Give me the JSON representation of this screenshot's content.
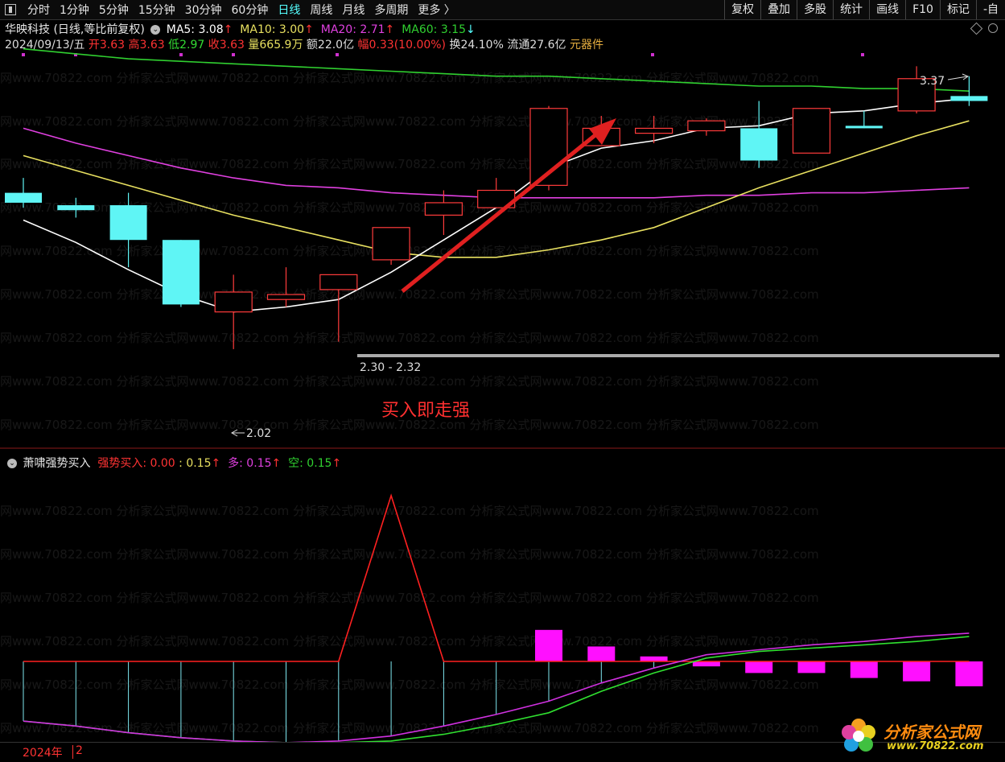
{
  "toolbar": {
    "periods": [
      "分时",
      "1分钟",
      "5分钟",
      "15分钟",
      "30分钟",
      "60分钟",
      "日线",
      "周线",
      "月线",
      "多周期",
      "更多 〉"
    ],
    "active_index": 6,
    "right_buttons": [
      "复权",
      "叠加",
      "多股",
      "统计",
      "画线",
      "F10",
      "标记",
      "-自"
    ]
  },
  "header": {
    "stock_name": "华映科技",
    "chart_mode": "(日线,等比前复权)",
    "ma5": "MA5: 3.08",
    "ma10": "MA10: 3.00",
    "ma20": "MA20: 2.71",
    "ma60": "MA60: 3.15",
    "arrow_up": "↑",
    "arrow_down": "↓",
    "date": "2024/09/13/五",
    "open": "开3.63",
    "high": "高3.63",
    "low": "低2.97",
    "close": "收3.63",
    "volume": "量665.9万",
    "amount": "额22.0亿",
    "change": "幅0.33(10.00%)",
    "turnover": "换24.10%",
    "float": "流通27.6亿",
    "sector": "元器件"
  },
  "annotations": {
    "high_label": "3.37",
    "low_label": "2.02",
    "range_label": "2.30 - 2.32",
    "buy_text": "买入即走强"
  },
  "indicator": {
    "name": "萧啸强势买入",
    "buy_label": "强势买入: 0.00",
    "v1": ": 0.15",
    "duo": "多: 0.15",
    "kong": "空: 0.15"
  },
  "watermark": "网www.70822.com 分析家公式网www.70822.com 分析家公式网www.70822.com 分析家公式网www.70822.com 分析家公式网www.70822.com",
  "bottom": {
    "year": "2024年",
    "page": "2"
  },
  "logo": {
    "name": "分析家公式网",
    "url": "www.70822.com"
  },
  "colors": {
    "up": "#ff3b3b",
    "down": "#5ff5f5",
    "ma5": "#ffffff",
    "ma10": "#e8e060",
    "ma20": "#e040e0",
    "ma60": "#30d030"
  },
  "chart_data": {
    "type": "candlestick",
    "ylim": [
      1.9,
      3.45
    ],
    "candles": [
      {
        "o": 2.9,
        "c": 2.86,
        "h": 2.96,
        "l": 2.84
      },
      {
        "o": 2.85,
        "c": 2.83,
        "h": 2.88,
        "l": 2.8
      },
      {
        "o": 2.85,
        "c": 2.71,
        "h": 2.9,
        "l": 2.6
      },
      {
        "o": 2.71,
        "c": 2.45,
        "h": 2.71,
        "l": 2.44
      },
      {
        "o": 2.42,
        "c": 2.5,
        "h": 2.57,
        "l": 2.27
      },
      {
        "o": 2.47,
        "c": 2.49,
        "h": 2.6,
        "l": 2.44
      },
      {
        "o": 2.51,
        "c": 2.57,
        "h": 2.57,
        "l": 2.3
      },
      {
        "o": 2.63,
        "c": 2.76,
        "h": 2.76,
        "l": 2.61
      },
      {
        "o": 2.81,
        "c": 2.86,
        "h": 2.91,
        "l": 2.73
      },
      {
        "o": 2.84,
        "c": 2.91,
        "h": 2.96,
        "l": 2.84
      },
      {
        "o": 2.93,
        "c": 3.24,
        "h": 3.25,
        "l": 2.91
      },
      {
        "o": 3.09,
        "c": 3.16,
        "h": 3.21,
        "l": 3.09
      },
      {
        "o": 3.14,
        "c": 3.16,
        "h": 3.21,
        "l": 3.1
      },
      {
        "o": 3.15,
        "c": 3.19,
        "h": 3.2,
        "l": 3.13
      },
      {
        "o": 3.16,
        "c": 3.03,
        "h": 3.27,
        "l": 3.0
      },
      {
        "o": 3.06,
        "c": 3.24,
        "h": 3.24,
        "l": 3.06
      },
      {
        "o": 3.17,
        "c": 3.16,
        "h": 3.23,
        "l": 3.16
      },
      {
        "o": 3.23,
        "c": 3.36,
        "h": 3.41,
        "l": 3.22
      },
      {
        "o": 3.29,
        "c": 3.27,
        "h": 3.37,
        "l": 3.25
      }
    ],
    "ma5": [
      2.79,
      2.7,
      2.59,
      2.49,
      2.42,
      2.44,
      2.47,
      2.58,
      2.71,
      2.84,
      3.0,
      3.08,
      3.11,
      3.16,
      3.17,
      3.22,
      3.23,
      3.26,
      3.28
    ],
    "ma10": [
      3.05,
      2.99,
      2.93,
      2.87,
      2.81,
      2.76,
      2.71,
      2.66,
      2.64,
      2.64,
      2.67,
      2.71,
      2.76,
      2.84,
      2.92,
      2.99,
      3.06,
      3.13,
      3.19
    ],
    "ma20": [
      3.16,
      3.1,
      3.05,
      3.0,
      2.96,
      2.93,
      2.92,
      2.9,
      2.89,
      2.88,
      2.88,
      2.88,
      2.88,
      2.89,
      2.89,
      2.9,
      2.9,
      2.91,
      2.92
    ],
    "ma60": [
      3.48,
      3.46,
      3.44,
      3.43,
      3.42,
      3.41,
      3.4,
      3.39,
      3.38,
      3.37,
      3.37,
      3.36,
      3.35,
      3.34,
      3.33,
      3.33,
      3.32,
      3.32,
      3.31
    ],
    "indicator": {
      "ylim": [
        -0.5,
        1.15
      ],
      "spike": [
        0,
        0,
        0,
        0,
        0,
        0,
        0,
        1,
        0,
        0,
        0,
        0,
        0,
        0,
        0,
        0,
        0,
        0,
        0
      ],
      "duo": [
        -0.36,
        -0.39,
        -0.43,
        -0.46,
        -0.48,
        -0.49,
        -0.48,
        -0.45,
        -0.39,
        -0.32,
        -0.24,
        -0.13,
        -0.04,
        0.04,
        0.07,
        0.1,
        0.12,
        0.15,
        0.17
      ],
      "kong": [
        -0.36,
        -0.39,
        -0.43,
        -0.46,
        -0.48,
        -0.49,
        -0.49,
        -0.48,
        -0.44,
        -0.38,
        -0.31,
        -0.18,
        -0.07,
        0.02,
        0.06,
        0.08,
        0.1,
        0.12,
        0.15
      ],
      "bars": [
        0,
        0,
        0,
        0,
        0,
        0,
        0,
        0,
        0,
        0,
        0.19,
        0.09,
        0.03,
        -0.03,
        -0.07,
        -0.07,
        -0.1,
        -0.12,
        -0.15
      ]
    }
  }
}
